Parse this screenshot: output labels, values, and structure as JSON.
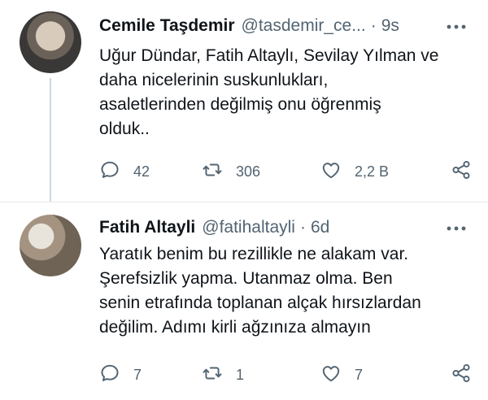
{
  "tweets": [
    {
      "author_name": "Cemile Taşdemir",
      "handle": "@tasdemir_ce...",
      "separator": "·",
      "time": "9s",
      "text": "Uğur Dündar, Fatih Altaylı, Sevilay Yılman ve\ndaha nicelerinin suskunlukları,\nasaletlerinden değilmiş onu öğrenmiş\nolduk..",
      "replies": "42",
      "retweets": "306",
      "likes": "2,2 B"
    },
    {
      "author_name": "Fatih Altayli",
      "handle": "@fatihaltayli",
      "separator": "·",
      "time": "6d",
      "text": "Yaratık benim bu rezillikle ne alakam var.\nŞerefsizlik yapma. Utanmaz olma. Ben\nsenin etrafında toplanan alçak hırsızlardan\ndeğilim. Adımı kirli ağzınıza almayın",
      "replies": "7",
      "retweets": "1",
      "likes": "7"
    }
  ],
  "icons": {
    "reply": "reply-icon",
    "retweet": "retweet-icon",
    "like": "heart-icon",
    "share": "share-icon",
    "more": "more-icon"
  },
  "colors": {
    "text": "#0f1419",
    "secondary": "#536471",
    "thread_line": "#cfd9de"
  }
}
